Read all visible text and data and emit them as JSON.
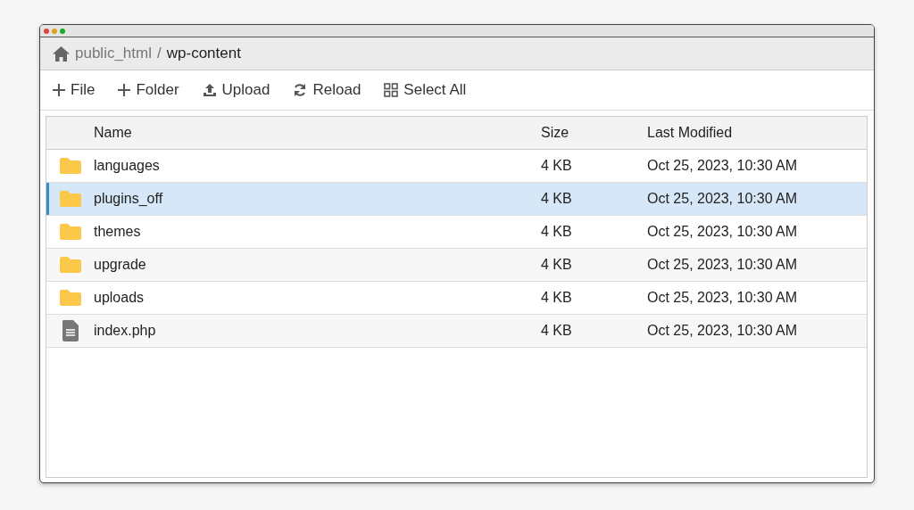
{
  "breadcrumb_separator": "/",
  "breadcrumb": [
    {
      "label": "public_html",
      "current": false
    },
    {
      "label": "wp-content",
      "current": true
    }
  ],
  "toolbar": [
    {
      "label": "File",
      "kind": "plus"
    },
    {
      "label": "Folder",
      "kind": "plus"
    },
    {
      "label": "Upload",
      "kind": "upload"
    },
    {
      "label": "Reload",
      "kind": "reload"
    },
    {
      "label": "Select All",
      "kind": "grid"
    }
  ],
  "table": {
    "columns": [
      "Name",
      "Size",
      "Last Modified"
    ],
    "rows": [
      {
        "kind": "folder",
        "name": "languages",
        "size": "4 KB",
        "modified": "Oct 25, 2023, 10:30 AM",
        "selected": false
      },
      {
        "kind": "folder",
        "name": "plugins_off",
        "size": "4 KB",
        "modified": "Oct 25, 2023, 10:30 AM",
        "selected": true
      },
      {
        "kind": "folder",
        "name": "themes",
        "size": "4 KB",
        "modified": "Oct 25, 2023, 10:30 AM",
        "selected": false
      },
      {
        "kind": "folder",
        "name": "upgrade",
        "size": "4 KB",
        "modified": "Oct 25, 2023, 10:30 AM",
        "selected": false
      },
      {
        "kind": "folder",
        "name": "uploads",
        "size": "4 KB",
        "modified": "Oct 25, 2023, 10:30 AM",
        "selected": false
      },
      {
        "kind": "file",
        "name": "index.php",
        "size": "4 KB",
        "modified": "Oct 25, 2023, 10:30 AM",
        "selected": false
      }
    ]
  }
}
